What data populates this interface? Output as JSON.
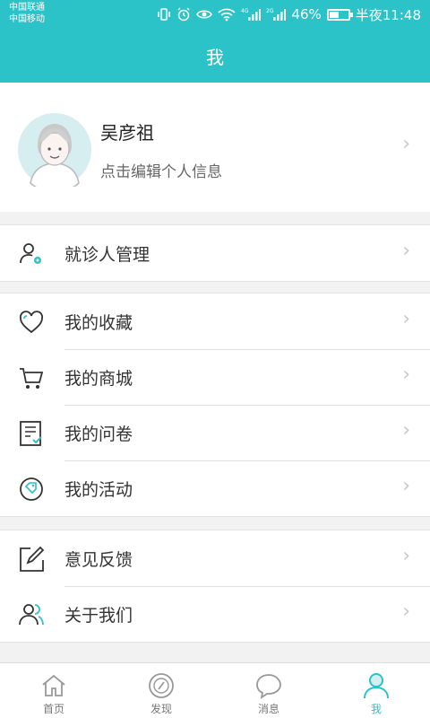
{
  "status_bar": {
    "carrier_1": "中国联通",
    "carrier_2": "中国移动",
    "battery_text": "46%",
    "battery_level": 0.46,
    "time": "半夜11:48"
  },
  "header": {
    "title": "我"
  },
  "profile": {
    "name": "吴彦祖",
    "subtitle": "点击编辑个人信息"
  },
  "groups": [
    {
      "items": [
        {
          "icon": "patient-manage-icon",
          "label": "就诊人管理"
        }
      ]
    },
    {
      "items": [
        {
          "icon": "heart-icon",
          "label": "我的收藏"
        },
        {
          "icon": "cart-icon",
          "label": "我的商城"
        },
        {
          "icon": "questionnaire-icon",
          "label": "我的问卷"
        },
        {
          "icon": "tag-icon",
          "label": "我的活动"
        }
      ]
    },
    {
      "items": [
        {
          "icon": "edit-icon",
          "label": "意见反馈"
        },
        {
          "icon": "users-icon",
          "label": "关于我们"
        }
      ]
    }
  ],
  "chevron": "›",
  "tabbar": {
    "tabs": [
      {
        "icon": "home-icon",
        "label": "首页"
      },
      {
        "icon": "compass-icon",
        "label": "发现"
      },
      {
        "icon": "chat-bubble-icon",
        "label": "消息"
      },
      {
        "icon": "person-icon",
        "label": "我"
      }
    ],
    "active": 3
  },
  "colors": {
    "accent": "#2cc3c8",
    "icon_dark": "#333333",
    "icon_accent": "#2cc3c8",
    "tab_inactive": "#999999"
  }
}
